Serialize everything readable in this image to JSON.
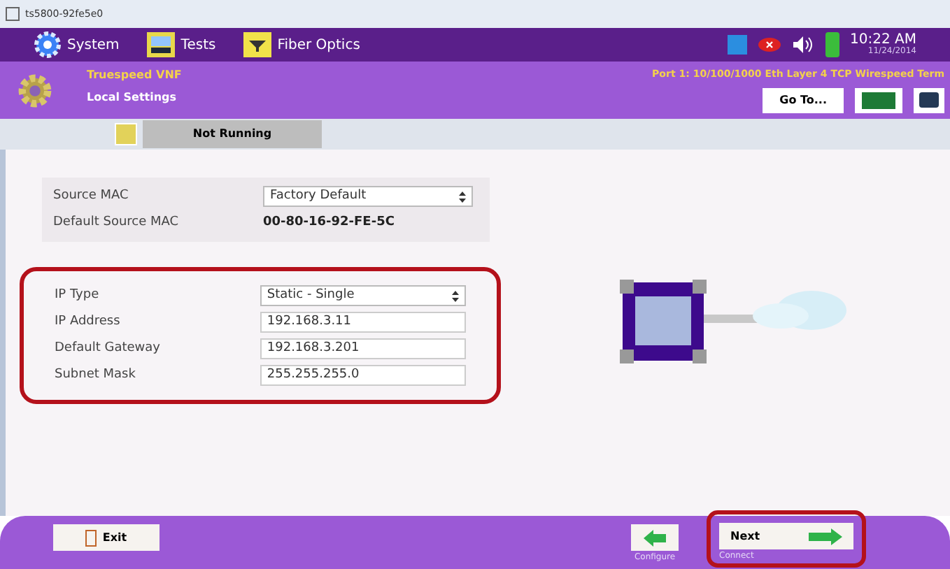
{
  "window": {
    "title": "ts5800-92fe5e0"
  },
  "menu": [
    {
      "label": "System",
      "kind": "gear"
    },
    {
      "label": "Tests",
      "kind": "tests"
    },
    {
      "label": "Fiber Optics",
      "kind": "fiber"
    }
  ],
  "status": {
    "time": "10:22 AM",
    "date": "11/24/2014"
  },
  "header": {
    "test_name": "Truespeed VNF",
    "page": "Local Settings",
    "port": "Port 1: 10/100/1000 Eth Layer 4 TCP Wirespeed Term",
    "goto": "Go To..."
  },
  "run_state": {
    "label": "Not Running"
  },
  "mac_settings": [
    {
      "kind": "select",
      "label": "Source MAC",
      "value": "Factory Default"
    },
    {
      "kind": "text",
      "label": "Default Source MAC",
      "value": "00-80-16-92-FE-5C"
    }
  ],
  "ip_settings": [
    {
      "kind": "select",
      "label": "IP Type",
      "value": "Static - Single"
    },
    {
      "kind": "input",
      "label": "IP Address",
      "value": "192.168.3.11"
    },
    {
      "kind": "input",
      "label": "Default Gateway",
      "value": "192.168.3.201"
    },
    {
      "kind": "input",
      "label": "Subnet Mask",
      "value": "255.255.255.0"
    }
  ],
  "footer": {
    "exit": "Exit",
    "back_caption": "Configure",
    "next": "Next",
    "next_caption": "Connect"
  }
}
